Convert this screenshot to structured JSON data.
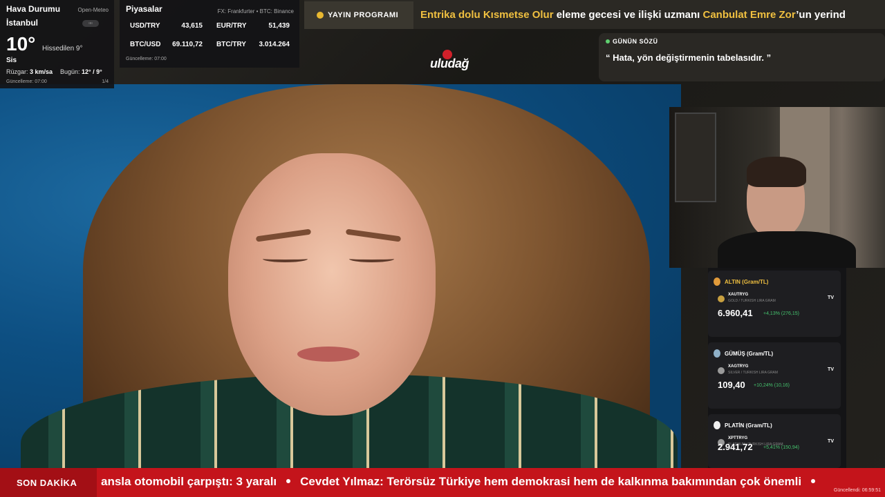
{
  "weather": {
    "title": "Hava Durumu",
    "source": "Open-Meteo",
    "city": "İstanbul",
    "temp": "10°",
    "feels_like": "Hissedilen 9°",
    "condition": "Sis",
    "wind_label": "Rüzgar:",
    "wind_value": "3 km/sa",
    "today_label": "Bugün:",
    "today_value": "12° / 9°",
    "updated": "Güncelleme: 07:00",
    "page": "1/4"
  },
  "markets": {
    "title": "Piyasalar",
    "source": "FX: Frankfurter • BTC: Binance",
    "rows": [
      {
        "pair": "USD/TRY",
        "value": "43,615",
        "pair2": "EUR/TRY",
        "value2": "51,439"
      },
      {
        "pair": "BTC/USD",
        "value": "69.110,72",
        "pair2": "BTC/TRY",
        "value2": "3.014.264"
      }
    ],
    "updated": "Güncelleme: 07:00"
  },
  "schedule": {
    "label": "YAYIN PROGRAMI",
    "msg_a": "Entrika dolu Kısmetse Olur",
    "msg_b": " eleme gecesi ve ilişki uzmanı ",
    "msg_c": "Canbulat Emre Zor",
    "msg_d": "’un yerind"
  },
  "logo": {
    "text": "uludağ"
  },
  "quote": {
    "label": "GÜNÜN SÖZÜ",
    "text": "“ Hata, yön değiştirmenin tabelasıdır. ”"
  },
  "commodities": [
    {
      "title": "ALTIN (Gram/TL)",
      "symbol": "XAUTRYG",
      "sub": "GOLD / TURKISH LIRA GRAM",
      "price": "6.960,41",
      "change": "+4,13% (276,15)",
      "medal_color": "#e09a3a",
      "coin_color": "#c8a040"
    },
    {
      "title": "GÜMÜŞ (Gram/TL)",
      "symbol": "XAGTRYG",
      "sub": "SILVER / TURKISH LIRA GRAM",
      "price": "109,40",
      "change": "+10,24% (10,16)",
      "medal_color": "#8fb0c8",
      "coin_color": "#9a9a9a"
    },
    {
      "title": "PLATİN (Gram/TL)",
      "symbol": "XPTTRYG",
      "sub": "PLATINUM / TURKISH LIRA GRAM",
      "price": "2.941,72",
      "change": "+5,41% (150,94)",
      "medal_color": "#f0f0f0",
      "coin_color": "#9a9a9a"
    }
  ],
  "tv_mark": "TV",
  "news": {
    "label": "SON DAKİKA",
    "item1": "ansla otomobil çarpıştı: 3 yaralı",
    "item2": "Cevdet Yılmaz: Terörsüz Türkiye hem demokrasi hem de kalkınma bakımından çok önemli",
    "updated": "Güncellendi: 06:59:51"
  }
}
